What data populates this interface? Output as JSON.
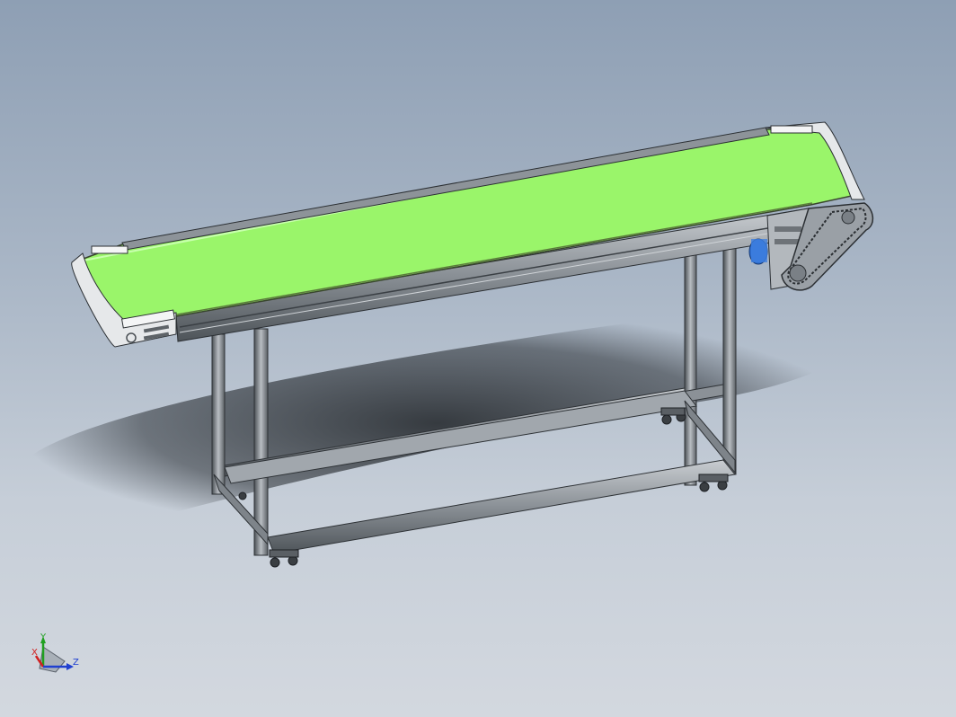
{
  "viewport": {
    "background_top": "#8e9fb4",
    "background_bottom": "#d3d8df"
  },
  "model": {
    "belt_color": "#9af56a",
    "frame_color": "#7d8389",
    "motor_color": "#2f6fd0"
  },
  "triad": {
    "x_label": "X",
    "y_label": "Y",
    "z_label": "Z",
    "x_color": "#d02020",
    "y_color": "#20a020",
    "z_color": "#2040d0"
  }
}
